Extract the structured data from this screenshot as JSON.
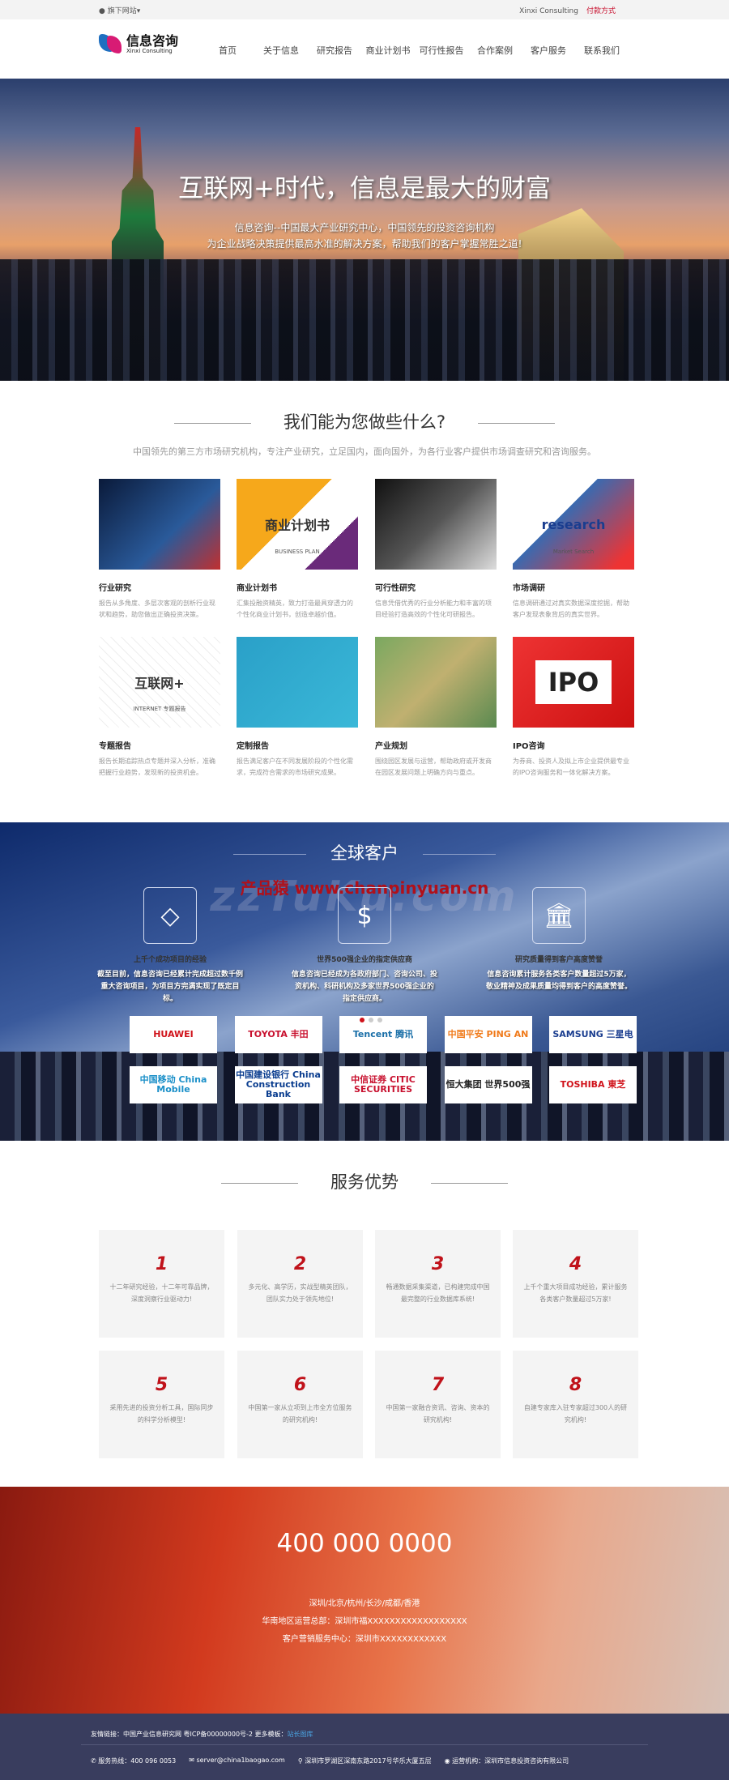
{
  "topbar": {
    "sites": "旗下网站▾",
    "brand_en": "Xinxi Consulting",
    "payment": "付款方式"
  },
  "header": {
    "logo_cn": "信息咨询",
    "logo_en": "Xinxi Consulting",
    "nav": [
      "首页",
      "关于信息",
      "研究报告",
      "商业计划书",
      "可行性报告",
      "合作案例",
      "客户服务",
      "联系我们"
    ]
  },
  "hero": {
    "title": "互联网+时代，信息是最大的财富",
    "line1": "信息咨询--中国最大产业研究中心，中国领先的投资咨询机构",
    "line2": "为企业战略决策提供最高水准的解决方案，帮助我们的客户掌握常胜之道!"
  },
  "services": {
    "title": "我们能为您做些什么?",
    "subtitle": "中国领先的第三方市场研究机构，专注产业研究，立足国内，面向国外，为各行业客户提供市场调查研究和咨询服务。",
    "items": [
      {
        "title": "行业研究",
        "desc": "报告从多角度、多层次客观的剖析行业现状和趋势，助您做出正确投资决策。",
        "img_text": ""
      },
      {
        "title": "商业计划书",
        "desc": "汇集投融资精英，致力打造最具穿透力的个性化商业计划书，创造卓越价值。",
        "img_text": "商业计划书",
        "img_sub": "BUSINESS PLAN"
      },
      {
        "title": "可行性研究",
        "desc": "信息凭借优秀的行业分析能力和丰富的项目经验打造高效的个性化可研报告。",
        "img_text": ""
      },
      {
        "title": "市场调研",
        "desc": "信息调研通过对真实数据深度挖掘，帮助客户发现表象背后的真实世界。",
        "img_text": "research",
        "img_sub": "Market Search"
      },
      {
        "title": "专题报告",
        "desc": "报告长期追踪热点专题并深入分析，准确把握行业趋势，发现新的投资机会。",
        "img_text": "互联网+",
        "img_sub": "INTERNET 专题报告"
      },
      {
        "title": "定制报告",
        "desc": "报告满足客户在不同发展阶段的个性化需求，完成符合需求的市场研究成果。",
        "img_text": ""
      },
      {
        "title": "产业规划",
        "desc": "围绕园区发展与运营，帮助政府或开发商在园区发展问题上明确方向与重点。",
        "img_text": ""
      },
      {
        "title": "IPO咨询",
        "desc": "为券商、投资人及拟上市企业提供最专业的IPO咨询服务和一体化解决方案。",
        "img_text": "IPO"
      }
    ]
  },
  "clients": {
    "title": "全球客户",
    "watermark": "产品猿 www.chanpinyuan.cn",
    "watermark2": "zzTuKu.com",
    "features": [
      {
        "icon": "diamond-icon",
        "title": "上千个成功项目的经验",
        "desc": "截至目前，信息咨询已经累计完成超过数千例重大咨询项目，为项目方完满实现了既定目标。"
      },
      {
        "icon": "dollar-icon",
        "title": "世界500强企业的指定供应商",
        "desc": "信息咨询已经成为各政府部门、咨询公司、投资机构、科研机构及多家世界500强企业的指定供应商。"
      },
      {
        "icon": "bank-icon",
        "title": "研究质量得到客户高度赞誉",
        "desc": "信息咨询累计服务各类客户数量超过5万家，敬业精神及成果质量均得到客户的高度赞誉。"
      }
    ],
    "logos": [
      {
        "name": "HUAWEI",
        "color": "#d0121a"
      },
      {
        "name": "TOYOTA 丰田",
        "color": "#c8102e"
      },
      {
        "name": "Tencent 腾讯",
        "color": "#1a6fa8"
      },
      {
        "name": "中国平安 PING AN",
        "color": "#f07a1a"
      },
      {
        "name": "SAMSUNG 三星电",
        "color": "#1a3d8f"
      },
      {
        "name": "中国移动 China Mobile",
        "color": "#1a8fc8"
      },
      {
        "name": "中国建设银行 China Construction Bank",
        "color": "#0a3d8f"
      },
      {
        "name": "中信证券 CITIC SECURITIES",
        "color": "#c8102e"
      },
      {
        "name": "恒大集团 世界500强",
        "color": "#222"
      },
      {
        "name": "TOSHIBA 東芝",
        "color": "#d0121a"
      }
    ]
  },
  "advantages": {
    "title": "服务优势",
    "items": [
      {
        "n": "1",
        "desc": "十二年研究经验，十二年可靠品牌，深度洞察行业驱动力!"
      },
      {
        "n": "2",
        "desc": "多元化、高学历，实战型精英团队，团队实力处于领先地位!"
      },
      {
        "n": "3",
        "desc": "畅通数据采集渠道，已构建完成中国最完整的行业数据库系统!"
      },
      {
        "n": "4",
        "desc": "上千个重大项目成功经验，累计服务各类客户数量超过5万家!"
      },
      {
        "n": "5",
        "desc": "采用先进的投资分析工具，国际同步的科学分析模型!"
      },
      {
        "n": "6",
        "desc": "中国第一家从立项到上市全方位服务的研究机构!"
      },
      {
        "n": "7",
        "desc": "中国第一家融合资讯、咨询、资本的研究机构!"
      },
      {
        "n": "8",
        "desc": "自建专家库入驻专家超过300人的研究机构!"
      }
    ]
  },
  "contact": {
    "phone": "400 000 0000",
    "cities": "深圳/北京/杭州/长沙/成都/香港",
    "hq": "华南地区运营总部：深圳市福XXXXXXXXXXXXXXXXXX",
    "center": "客户营销服务中心：深圳市XXXXXXXXXXXX"
  },
  "footer": {
    "links_label": "友情链接：中国产业信息研究网 粤ICP备00000000号-2 更多模板：",
    "links_link": "站长图库",
    "hotline": "服务热线：400 096 0053",
    "email": "server@china1baogao.com",
    "address": "深圳市罗湖区深南东路2017号华乐大厦五层",
    "operator": "运营机构：深圳市信息投资咨询有限公司"
  }
}
